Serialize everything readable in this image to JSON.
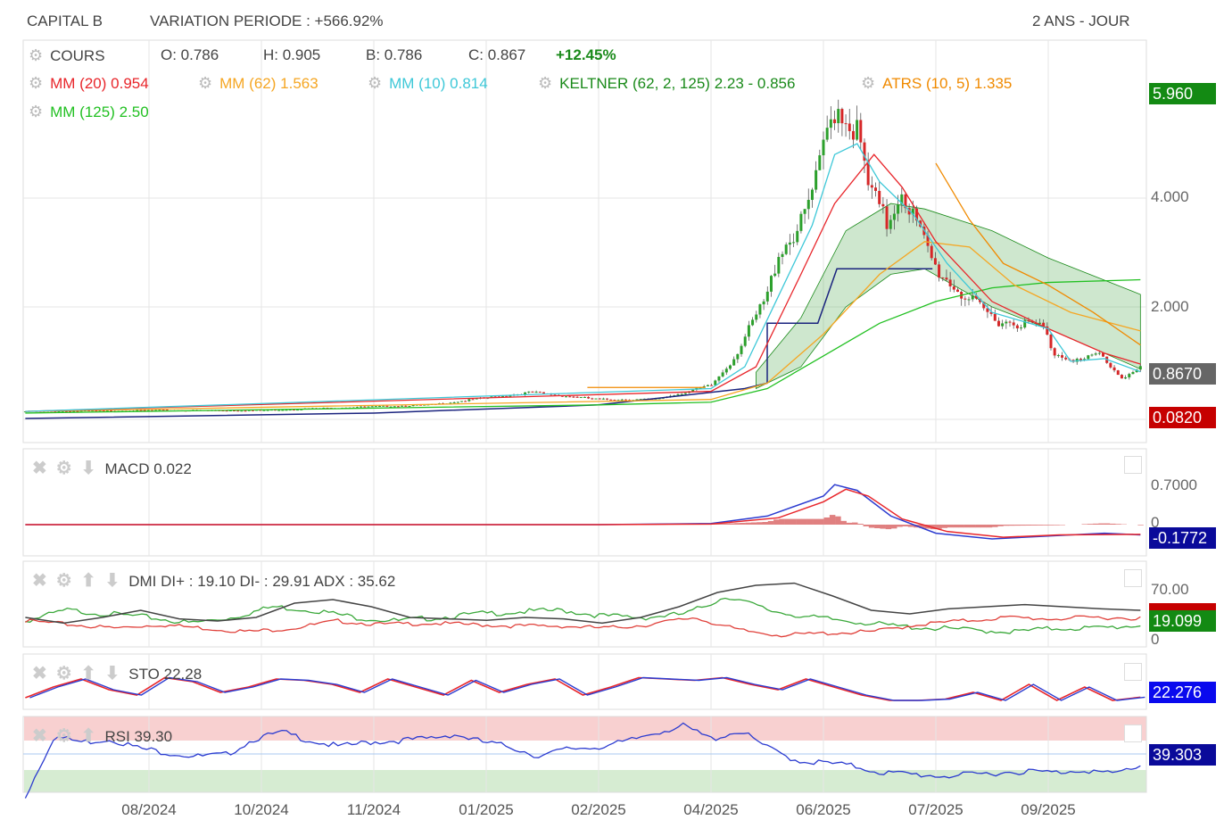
{
  "header": {
    "title": "CAPITAL B",
    "variation": "VARIATION PERIODE : +566.92%",
    "period": "2 ANS - JOUR"
  },
  "quote": {
    "label": "COURS",
    "open": "O: 0.786",
    "high": "H: 0.905",
    "low": "B: 0.786",
    "close": "C: 0.867",
    "change": "+12.45%"
  },
  "legend": {
    "mm20": "MM (20)",
    "mm20_v": "0.954",
    "mm62": "MM (62)",
    "mm62_v": "1.563",
    "mm10": "MM (10)",
    "mm10_v": "0.814",
    "keltner": "KELTNER (62, 2, 125)",
    "keltner_v": "2.23 - 0.856",
    "atrs": "ATRS (10, 5)",
    "atrs_v": "1.335",
    "mm125": "MM (125)",
    "mm125_v": "2.50"
  },
  "axis": {
    "main": [
      "4.000",
      "2.000"
    ],
    "top_tag": "5.960",
    "last_tag": "0.8670",
    "low_tag": "0.0820",
    "macd": [
      "0.7000",
      "0"
    ],
    "macd_tag": "-0.1772",
    "dmi": [
      "70.00",
      "0"
    ],
    "dmi_tag": "19.099",
    "sto_tag": "22.276",
    "rsi_tag": "39.303"
  },
  "panels": {
    "macd": "MACD",
    "macd_v": "0.022",
    "dmi": "DMI",
    "dmi_v": "DI+ : 19.10 DI- : 29.91 ADX : 35.62",
    "sto": "STO",
    "sto_v": "22.28",
    "rsi": "RSI",
    "rsi_v": "39.30"
  },
  "colors": {
    "up": "#2ca02c",
    "down": "#d62728",
    "mm20": "#e8262b",
    "mm62": "#f5a623",
    "mm10": "#3ec8d8",
    "keltner": "#1a8a1a",
    "atrs": "#f08a00",
    "mm125": "#22c022",
    "step": "#1a237e"
  },
  "chart_data": {
    "type": "line",
    "xlabels": [
      "08/2024",
      "10/2024",
      "11/2024",
      "01/2025",
      "02/2025",
      "04/2025",
      "06/2025",
      "07/2025",
      "09/2025"
    ],
    "xlabel_positions": [
      1,
      2,
      3,
      4,
      5,
      6,
      7,
      8,
      9
    ],
    "price": [
      [
        -0.1,
        0.08
      ],
      [
        1,
        0.1
      ],
      [
        2,
        0.1
      ],
      [
        2.7,
        0.15
      ],
      [
        3.5,
        0.2
      ],
      [
        4.4,
        0.43
      ],
      [
        5,
        0.3
      ],
      [
        5.5,
        0.3
      ],
      [
        6,
        0.55
      ],
      [
        6.2,
        1.05
      ],
      [
        6.5,
        2.2
      ],
      [
        6.6,
        3.0
      ],
      [
        6.8,
        3.5
      ],
      [
        6.95,
        4.4
      ],
      [
        7.03,
        5.2
      ],
      [
        7.11,
        5.75
      ],
      [
        7.3,
        5.2
      ],
      [
        7.4,
        4.2
      ],
      [
        7.57,
        3.5
      ],
      [
        7.69,
        4.2
      ],
      [
        7.85,
        3.4
      ],
      [
        8.0,
        2.7
      ],
      [
        8.25,
        2.2
      ],
      [
        8.55,
        1.75
      ],
      [
        8.95,
        1.65
      ],
      [
        9.05,
        1.15
      ],
      [
        9.3,
        1.0
      ],
      [
        9.45,
        1.15
      ],
      [
        9.65,
        0.7
      ],
      [
        9.82,
        0.867
      ]
    ],
    "mm10": [
      [
        -0.1,
        0.08
      ],
      [
        6,
        0.5
      ],
      [
        6.3,
        0.9
      ],
      [
        6.6,
        2.2
      ],
      [
        6.9,
        3.5
      ],
      [
        7.1,
        4.8
      ],
      [
        7.3,
        5.0
      ],
      [
        7.5,
        4.3
      ],
      [
        7.8,
        3.7
      ],
      [
        8.1,
        2.8
      ],
      [
        8.5,
        1.9
      ],
      [
        9,
        1.6
      ],
      [
        9.2,
        1.0
      ],
      [
        9.5,
        1.05
      ],
      [
        9.82,
        0.81
      ]
    ],
    "mm20": [
      [
        -0.1,
        0.08
      ],
      [
        6,
        0.45
      ],
      [
        6.4,
        0.9
      ],
      [
        6.8,
        2.6
      ],
      [
        7.1,
        3.9
      ],
      [
        7.45,
        4.8
      ],
      [
        7.7,
        4.2
      ],
      [
        8,
        3.2
      ],
      [
        8.5,
        2.1
      ],
      [
        9,
        1.6
      ],
      [
        9.5,
        1.15
      ],
      [
        9.82,
        0.95
      ]
    ],
    "mm62": [
      [
        -0.1,
        0.08
      ],
      [
        6,
        0.3
      ],
      [
        6.5,
        0.6
      ],
      [
        7,
        1.5
      ],
      [
        7.5,
        2.6
      ],
      [
        7.9,
        3.2
      ],
      [
        8.3,
        3.1
      ],
      [
        8.7,
        2.4
      ],
      [
        9.2,
        1.9
      ],
      [
        9.82,
        1.56
      ]
    ],
    "mm125": [
      [
        -0.1,
        0.05
      ],
      [
        5,
        0.2
      ],
      [
        6,
        0.25
      ],
      [
        6.5,
        0.5
      ],
      [
        7,
        1.1
      ],
      [
        7.5,
        1.7
      ],
      [
        8,
        2.1
      ],
      [
        8.5,
        2.35
      ],
      [
        9,
        2.45
      ],
      [
        9.82,
        2.5
      ]
    ],
    "atrs": [
      [
        [
          4.9,
          0.52
        ],
        [
          5.95,
          0.52
        ]
      ],
      [
        [
          8.0,
          4.64
        ],
        [
          8.3,
          3.6
        ],
        [
          8.6,
          2.8
        ],
        [
          9.0,
          2.4
        ],
        [
          9.4,
          1.9
        ],
        [
          9.82,
          1.3
        ]
      ]
    ],
    "keltner_upper": [
      [
        6.4,
        0.8
      ],
      [
        6.8,
        1.8
      ],
      [
        7.2,
        3.4
      ],
      [
        7.6,
        3.9
      ],
      [
        7.9,
        3.8
      ],
      [
        8.5,
        3.4
      ],
      [
        9,
        2.9
      ],
      [
        9.82,
        2.23
      ]
    ],
    "keltner_lower": [
      [
        6.4,
        0.5
      ],
      [
        6.8,
        0.9
      ],
      [
        7.2,
        2.0
      ],
      [
        7.6,
        2.6
      ],
      [
        7.9,
        2.7
      ],
      [
        8.5,
        2.0
      ],
      [
        9,
        1.6
      ],
      [
        9.82,
        0.86
      ]
    ],
    "step": [
      [
        -0.1,
        -0.05
      ],
      [
        3,
        0.05
      ],
      [
        5,
        0.2
      ],
      [
        6.3,
        0.5
      ],
      [
        6.5,
        0.6
      ],
      [
        6.5,
        1.7
      ],
      [
        6.95,
        1.7
      ],
      [
        7.12,
        2.7
      ],
      [
        7.97,
        2.7
      ]
    ],
    "macd": [
      [
        -0.1,
        0
      ],
      [
        5,
        0
      ],
      [
        6,
        0.02
      ],
      [
        6.5,
        0.15
      ],
      [
        7,
        0.5
      ],
      [
        7.1,
        0.7
      ],
      [
        7.3,
        0.6
      ],
      [
        7.6,
        0.15
      ],
      [
        8,
        -0.15
      ],
      [
        8.5,
        -0.25
      ],
      [
        9,
        -0.2
      ],
      [
        9.5,
        -0.15
      ],
      [
        9.82,
        -0.18
      ]
    ],
    "macd_signal": [
      [
        -0.1,
        0
      ],
      [
        5,
        0
      ],
      [
        6,
        0.01
      ],
      [
        6.6,
        0.12
      ],
      [
        7,
        0.4
      ],
      [
        7.2,
        0.62
      ],
      [
        7.4,
        0.5
      ],
      [
        7.7,
        0.1
      ],
      [
        8.1,
        -0.12
      ],
      [
        8.6,
        -0.22
      ],
      [
        9.1,
        -0.18
      ],
      [
        9.82,
        -0.17
      ]
    ],
    "adx": [
      30,
      22,
      30,
      40,
      28,
      25,
      30,
      50,
      55,
      45,
      30,
      28,
      26,
      30,
      28,
      22,
      30,
      45,
      65,
      75,
      78,
      60,
      40,
      35,
      42,
      45,
      48,
      45,
      42,
      40
    ],
    "di_plus": [
      25,
      40,
      35,
      30,
      22,
      30,
      45,
      40,
      30,
      25,
      30,
      35,
      38,
      40,
      32,
      30,
      35,
      60,
      40,
      30,
      25,
      18,
      15,
      12,
      10,
      15,
      15,
      19
    ],
    "di_minus": [
      25,
      20,
      15,
      20,
      15,
      10,
      15,
      25,
      20,
      22,
      20,
      18,
      18,
      15,
      20,
      30,
      12,
      5,
      8,
      10,
      20,
      25,
      30,
      28,
      30,
      29
    ],
    "sto": [
      20,
      60,
      90,
      50,
      30,
      95,
      80,
      40,
      60,
      90,
      85,
      70,
      40,
      90,
      60,
      30,
      85,
      40,
      70,
      90,
      30,
      60,
      95,
      90,
      85,
      95,
      70,
      50,
      90,
      60,
      30,
      10,
      10,
      15,
      40,
      10,
      70,
      10,
      60,
      10,
      22
    ],
    "rsi": [
      0,
      75,
      68,
      72,
      60,
      55,
      50,
      52,
      72,
      80,
      70,
      62,
      68,
      70,
      72,
      78,
      68,
      62,
      50,
      60,
      62,
      68,
      80,
      88,
      72,
      82,
      60,
      45,
      42,
      38,
      30,
      28,
      26,
      27,
      30,
      32,
      30,
      34,
      28,
      39
    ]
  }
}
